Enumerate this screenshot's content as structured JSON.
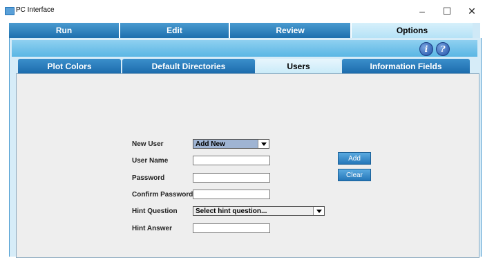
{
  "window": {
    "title": "PC Interface",
    "minimize": "–",
    "maximize": "☐",
    "close": "✕"
  },
  "main_tabs": [
    {
      "label": "Run"
    },
    {
      "label": "Edit"
    },
    {
      "label": "Review"
    },
    {
      "label": "Options"
    }
  ],
  "toolbar": {
    "info_label": "i",
    "help_label": "?"
  },
  "sub_tabs": [
    {
      "label": "Plot Colors"
    },
    {
      "label": "Default Directories"
    },
    {
      "label": "Users"
    },
    {
      "label": "Information Fields"
    }
  ],
  "form": {
    "new_user_label": "New User",
    "new_user_value": "Add New",
    "user_name_label": "User Name",
    "password_label": "Password",
    "confirm_password_label": "Confirm Password",
    "hint_question_label": "Hint Question",
    "hint_question_value": "Select hint question...",
    "hint_answer_label": "Hint Answer",
    "add_label": "Add",
    "clear_label": "Clear"
  },
  "colors": {
    "tab_blue": "#1d6fae",
    "active_tab": "#c8eaf8",
    "panel_bg": "#eeeeee",
    "new_user_combo": "#9fb4d3"
  }
}
